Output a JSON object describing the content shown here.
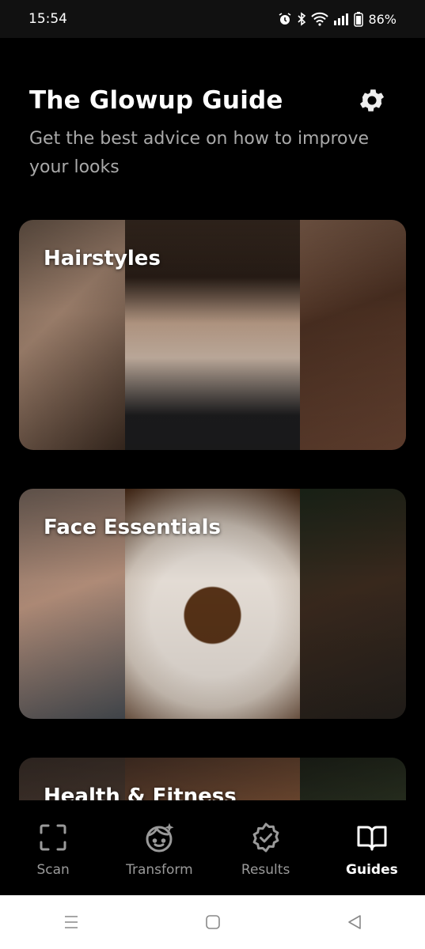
{
  "status": {
    "time": "15:54",
    "battery": "86%",
    "icons": [
      "alarm-icon",
      "bluetooth-icon",
      "wifi-icon",
      "signal-icon",
      "battery-icon"
    ]
  },
  "header": {
    "title": "The Glowup Guide",
    "subtitle": "Get the best advice on how to improve your looks"
  },
  "cards": [
    {
      "label": "Hairstyles"
    },
    {
      "label": "Face Essentials"
    },
    {
      "label": "Health & Fitness"
    }
  ],
  "nav": {
    "items": [
      {
        "label": "Scan",
        "icon": "scan-icon"
      },
      {
        "label": "Transform",
        "icon": "transform-icon"
      },
      {
        "label": "Results",
        "icon": "results-icon"
      },
      {
        "label": "Guides",
        "icon": "guides-icon",
        "active": true
      }
    ]
  },
  "colors": {
    "background": "#000000",
    "subtitle": "#a9a9a9",
    "inactive": "#9a9a9a"
  }
}
